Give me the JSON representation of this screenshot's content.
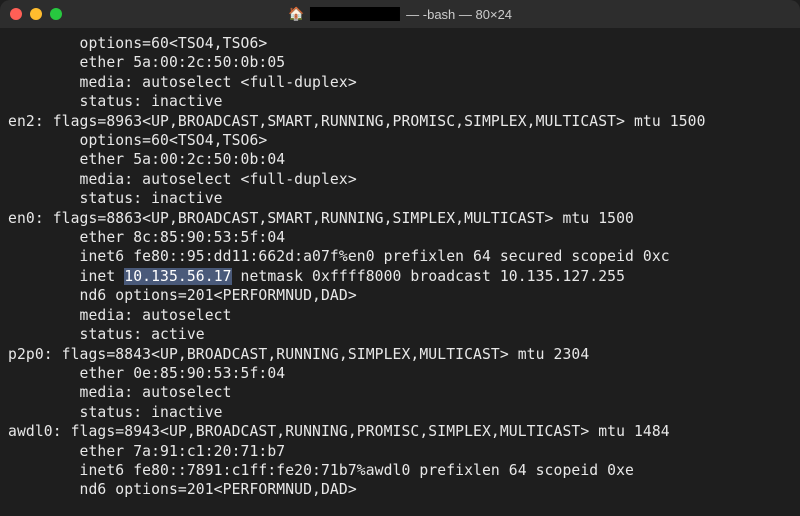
{
  "titlebar": {
    "title_suffix": " — -bash — 80×24"
  },
  "terminal": {
    "lines": [
      "        options=60<TSO4,TSO6>",
      "        ether 5a:00:2c:50:0b:05",
      "        media: autoselect <full-duplex>",
      "        status: inactive",
      "en2: flags=8963<UP,BROADCAST,SMART,RUNNING,PROMISC,SIMPLEX,MULTICAST> mtu 1500",
      "        options=60<TSO4,TSO6>",
      "        ether 5a:00:2c:50:0b:04",
      "        media: autoselect <full-duplex>",
      "        status: inactive",
      "en0: flags=8863<UP,BROADCAST,SMART,RUNNING,SIMPLEX,MULTICAST> mtu 1500",
      "        ether 8c:85:90:53:5f:04",
      "        inet6 fe80::95:dd11:662d:a07f%en0 prefixlen 64 secured scopeid 0xc",
      "        inet ",
      " netmask 0xffff8000 broadcast 10.135.127.255",
      "        nd6 options=201<PERFORMNUD,DAD>",
      "        media: autoselect",
      "        status: active",
      "p2p0: flags=8843<UP,BROADCAST,RUNNING,SIMPLEX,MULTICAST> mtu 2304",
      "        ether 0e:85:90:53:5f:04",
      "        media: autoselect",
      "        status: inactive",
      "awdl0: flags=8943<UP,BROADCAST,RUNNING,PROMISC,SIMPLEX,MULTICAST> mtu 1484",
      "        ether 7a:91:c1:20:71:b7",
      "        inet6 fe80::7891:c1ff:fe20:71b7%awdl0 prefixlen 64 scopeid 0xe",
      "        nd6 options=201<PERFORMNUD,DAD>"
    ],
    "highlighted_ip": "10.135.56.17"
  }
}
